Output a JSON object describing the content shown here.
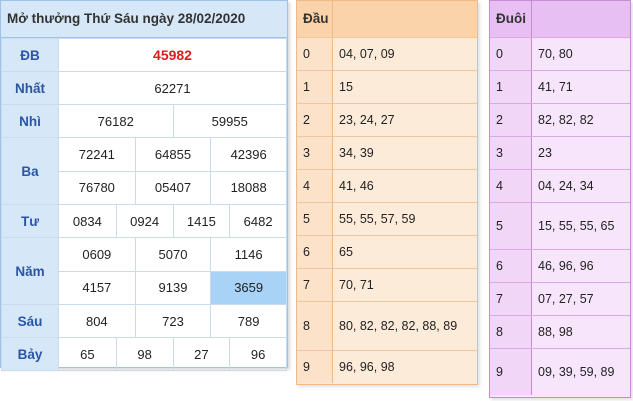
{
  "result": {
    "title": "Mở thưởng Thứ Sáu ngày 28/02/2020",
    "db_label": "ĐB",
    "db": "45982",
    "nhat_label": "Nhất",
    "nhat": "62271",
    "nhi_label": "Nhì",
    "nhi": [
      "76182",
      "59955"
    ],
    "ba_label": "Ba",
    "ba": [
      "72241",
      "64855",
      "42396",
      "76780",
      "05407",
      "18088"
    ],
    "tu_label": "Tư",
    "tu": [
      "0834",
      "0924",
      "1415",
      "6482"
    ],
    "nam_label": "Năm",
    "nam": [
      "0609",
      "5070",
      "1146",
      "4157",
      "9139",
      "3659"
    ],
    "sau_label": "Sáu",
    "sau": [
      "804",
      "723",
      "789"
    ],
    "bay_label": "Bảy",
    "bay": [
      "65",
      "98",
      "27",
      "96"
    ]
  },
  "dau": {
    "title": "Đầu",
    "rows": [
      {
        "k": "0",
        "v": "04, 07, 09"
      },
      {
        "k": "1",
        "v": "15"
      },
      {
        "k": "2",
        "v": "23, 24, 27"
      },
      {
        "k": "3",
        "v": "34, 39"
      },
      {
        "k": "4",
        "v": "41, 46"
      },
      {
        "k": "5",
        "v": "55, 55, 57, 59"
      },
      {
        "k": "6",
        "v": "65"
      },
      {
        "k": "7",
        "v": "70, 71"
      },
      {
        "k": "8",
        "v": "80, 82, 82, 82, 88, 89"
      },
      {
        "k": "9",
        "v": "96, 96, 98"
      }
    ]
  },
  "duoi": {
    "title": "Đuôi",
    "rows": [
      {
        "k": "0",
        "v": "70, 80"
      },
      {
        "k": "1",
        "v": "41, 71"
      },
      {
        "k": "2",
        "v": "82, 82, 82"
      },
      {
        "k": "3",
        "v": "23"
      },
      {
        "k": "4",
        "v": "04, 24, 34"
      },
      {
        "k": "5",
        "v": "15, 55, 55, 65"
      },
      {
        "k": "6",
        "v": "46, 96, 96"
      },
      {
        "k": "7",
        "v": "07, 27, 57"
      },
      {
        "k": "8",
        "v": "88, 98"
      },
      {
        "k": "9",
        "v": "09, 39, 59, 89"
      }
    ]
  }
}
